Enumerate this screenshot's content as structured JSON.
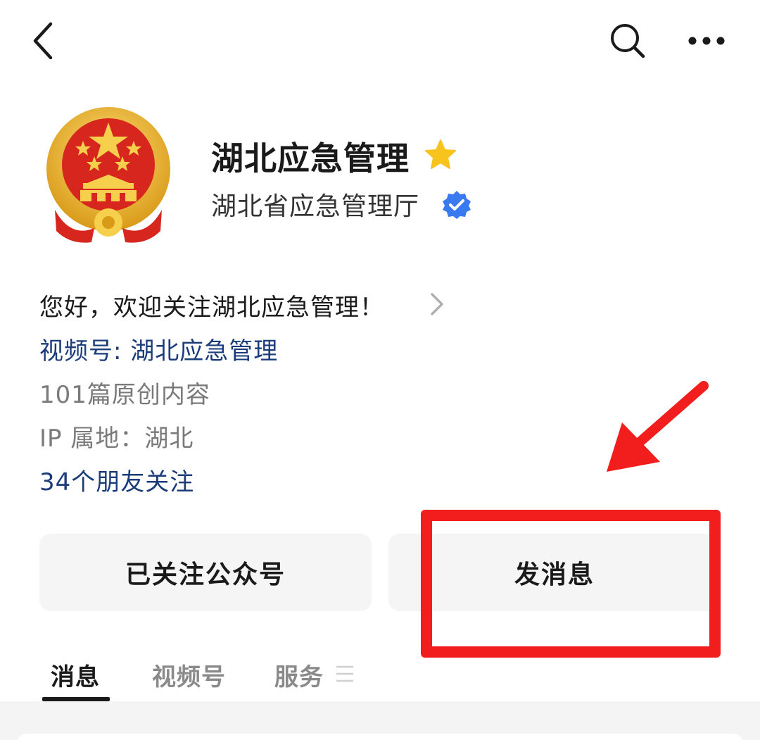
{
  "header": {
    "back_icon": "chevron-left-icon",
    "search_icon": "search-icon",
    "more_icon": "more-horizontal-icon"
  },
  "profile": {
    "account_name": "湖北应急管理",
    "org_name": "湖北省应急管理厅",
    "emblem_icon": "national-emblem-icon",
    "star_badge_color": "#f7c31c",
    "verified_badge_color": "#3a7af0"
  },
  "info": {
    "intro": "您好，欢迎关注湖北应急管理！",
    "channel": "视频号: 湖北应急管理",
    "original_count": "101篇原创内容",
    "ip_location": "IP 属地：湖北",
    "friends_following": "34个朋友关注"
  },
  "actions": {
    "follow_label": "已关注公众号",
    "message_label": "发消息"
  },
  "tabs": [
    {
      "label": "消息",
      "active": true
    },
    {
      "label": "视频号",
      "active": false
    },
    {
      "label": "服务",
      "active": false
    }
  ],
  "colors": {
    "link_blue": "#1b3c7a",
    "annotation_red": "#f21d1d",
    "button_bg": "#f5f5f5"
  }
}
